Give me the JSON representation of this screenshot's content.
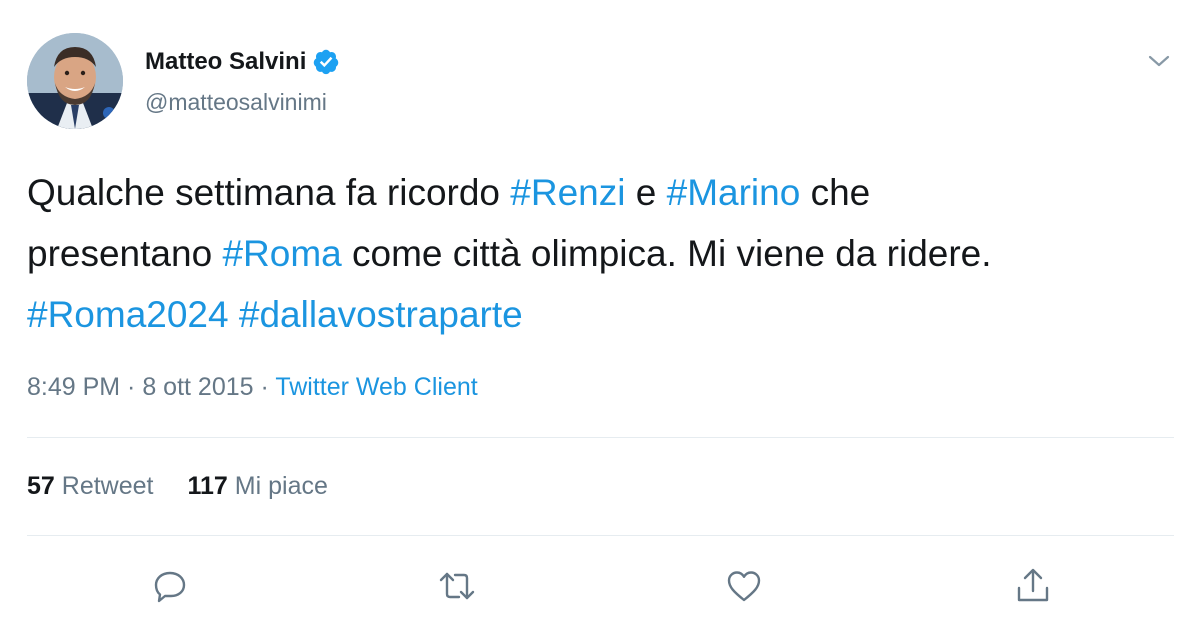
{
  "author": {
    "name": "Matteo Salvini",
    "handle": "@matteosalvinimi",
    "verified_icon": "verified-badge"
  },
  "tweet": {
    "lines": [
      [
        {
          "text": "Qualche settimana fa ricordo ",
          "hashtag": false
        },
        {
          "text": "#Renzi",
          "hashtag": true
        },
        {
          "text": " e ",
          "hashtag": false
        },
        {
          "text": "#Marino",
          "hashtag": true
        },
        {
          "text": " che",
          "hashtag": false
        }
      ],
      [
        {
          "text": "presentano ",
          "hashtag": false
        },
        {
          "text": "#Roma",
          "hashtag": true
        },
        {
          "text": " come città olimpica. Mi viene da ridere.",
          "hashtag": false
        }
      ],
      [
        {
          "text": "#Roma2024",
          "hashtag": true
        },
        {
          "text": " ",
          "hashtag": false
        },
        {
          "text": "#dallavostraparte",
          "hashtag": true
        }
      ]
    ]
  },
  "meta": {
    "time": "8:49 PM",
    "sep": " · ",
    "date": "8 ott 2015",
    "source": "Twitter Web Client"
  },
  "stats": {
    "retweets": {
      "count": "57",
      "label": "Retweet"
    },
    "likes": {
      "count": "117",
      "label": "Mi piace"
    }
  },
  "actions": [
    "reply-icon",
    "retweet-icon",
    "like-icon",
    "share-icon"
  ],
  "colors": {
    "link": "#1b95e0",
    "text": "#14171a",
    "muted": "#657786",
    "divider": "#e6ecf0"
  }
}
